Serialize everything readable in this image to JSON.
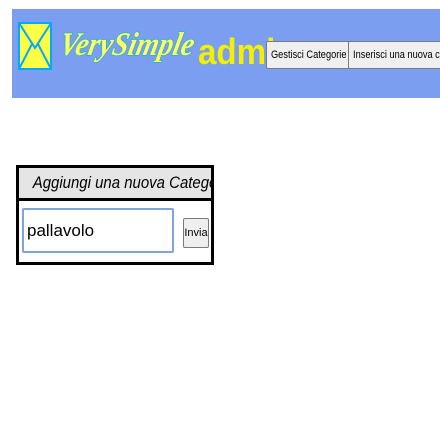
{
  "header": {
    "logo_text": "VerySimple",
    "admin_label": "admin",
    "nav": [
      {
        "label": "Gestisci Categorie"
      },
      {
        "label": "Inserisci una nuova categoria"
      }
    ]
  },
  "form": {
    "title": "Aggiungi una nuova Categoria",
    "category_value": "pallavolo",
    "submit_label": "Invia"
  },
  "colors": {
    "header_bg": "#7b9ef0",
    "admin_text": "#f3f000",
    "logo_fill": "#ffff66"
  },
  "icons": {
    "logo": "envelope-icon"
  }
}
